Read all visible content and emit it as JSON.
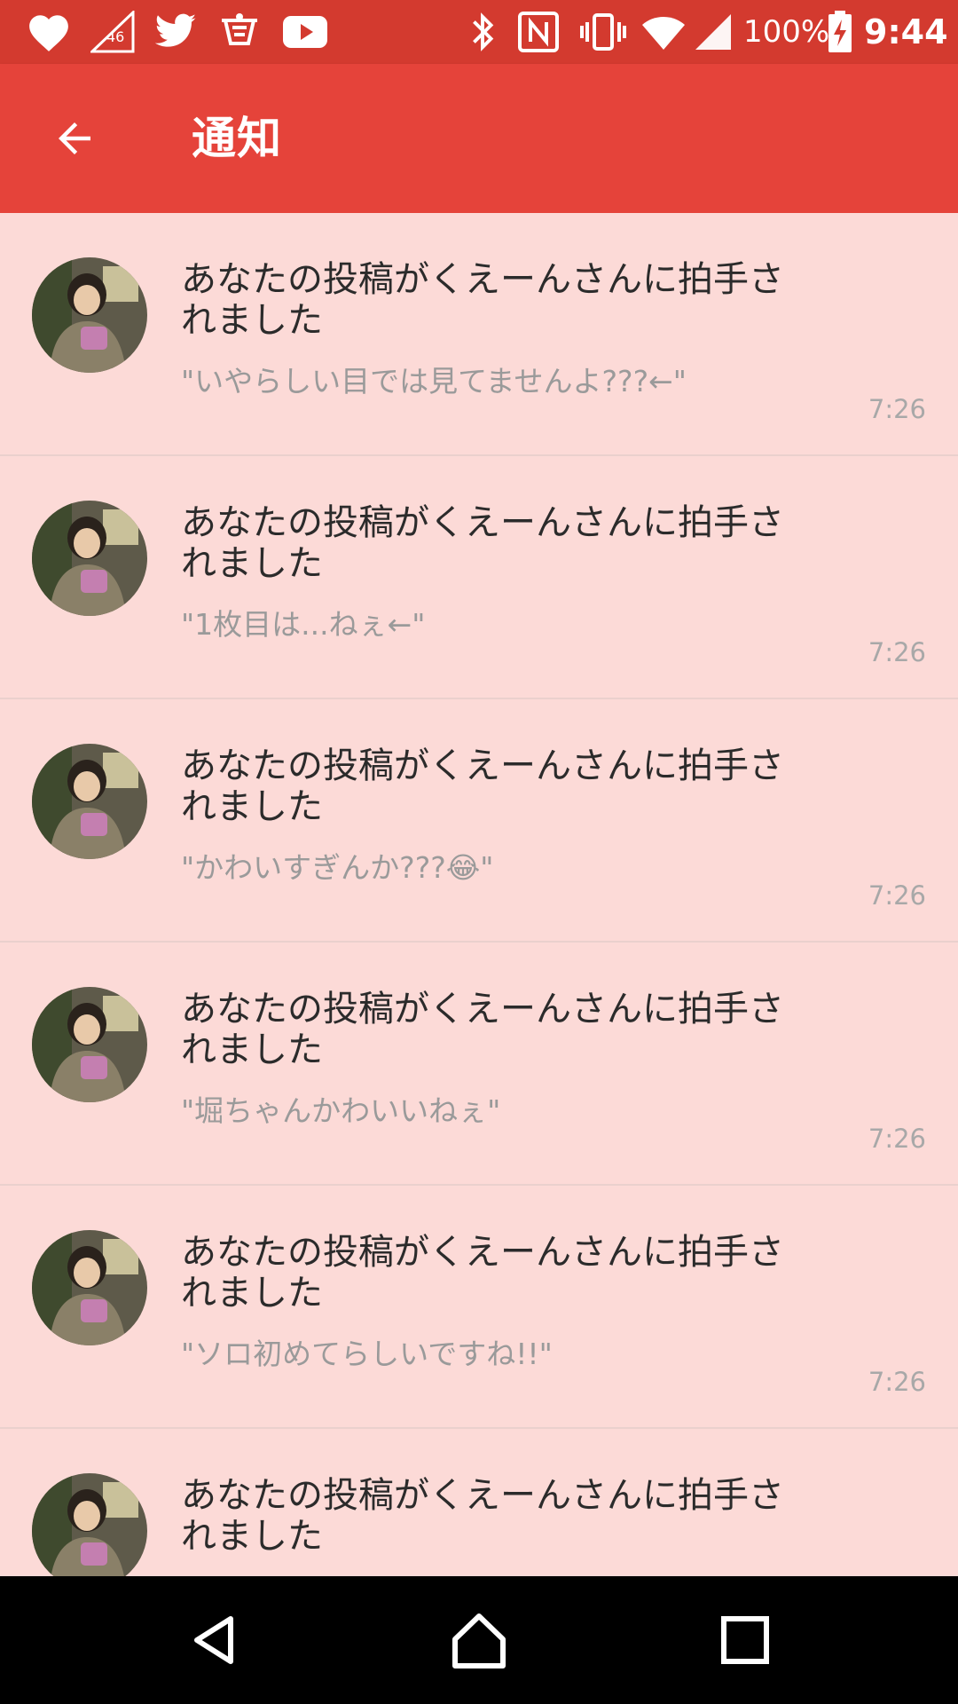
{
  "status_bar": {
    "network_badge": "46",
    "battery_text": "100%",
    "time": "9:44"
  },
  "app_bar": {
    "title": "通知"
  },
  "notifications": [
    {
      "title": "あなたの投稿がくえーんさんに拍手されました",
      "comment": "\"いやらしい目では見てませんよ???←\"",
      "time": "7:26"
    },
    {
      "title": "あなたの投稿がくえーんさんに拍手されました",
      "comment": "\"1枚目は...ねぇ←\"",
      "time": "7:26"
    },
    {
      "title": "あなたの投稿がくえーんさんに拍手されました",
      "comment": "\"かわいすぎんか???😂\"",
      "time": "7:26"
    },
    {
      "title": "あなたの投稿がくえーんさんに拍手されました",
      "comment": "\"堀ちゃんかわいいねぇ\"",
      "time": "7:26"
    },
    {
      "title": "あなたの投稿がくえーんさんに拍手されました",
      "comment": "\"ソロ初めてらしいですね!!\"",
      "time": "7:26"
    },
    {
      "title": "あなたの投稿がくえーんさんに拍手されました",
      "comment": "",
      "time": ""
    }
  ],
  "colors": {
    "status_bar": "#d33a2f",
    "app_bar": "#e5433a",
    "list_background": "#fcdad7"
  }
}
